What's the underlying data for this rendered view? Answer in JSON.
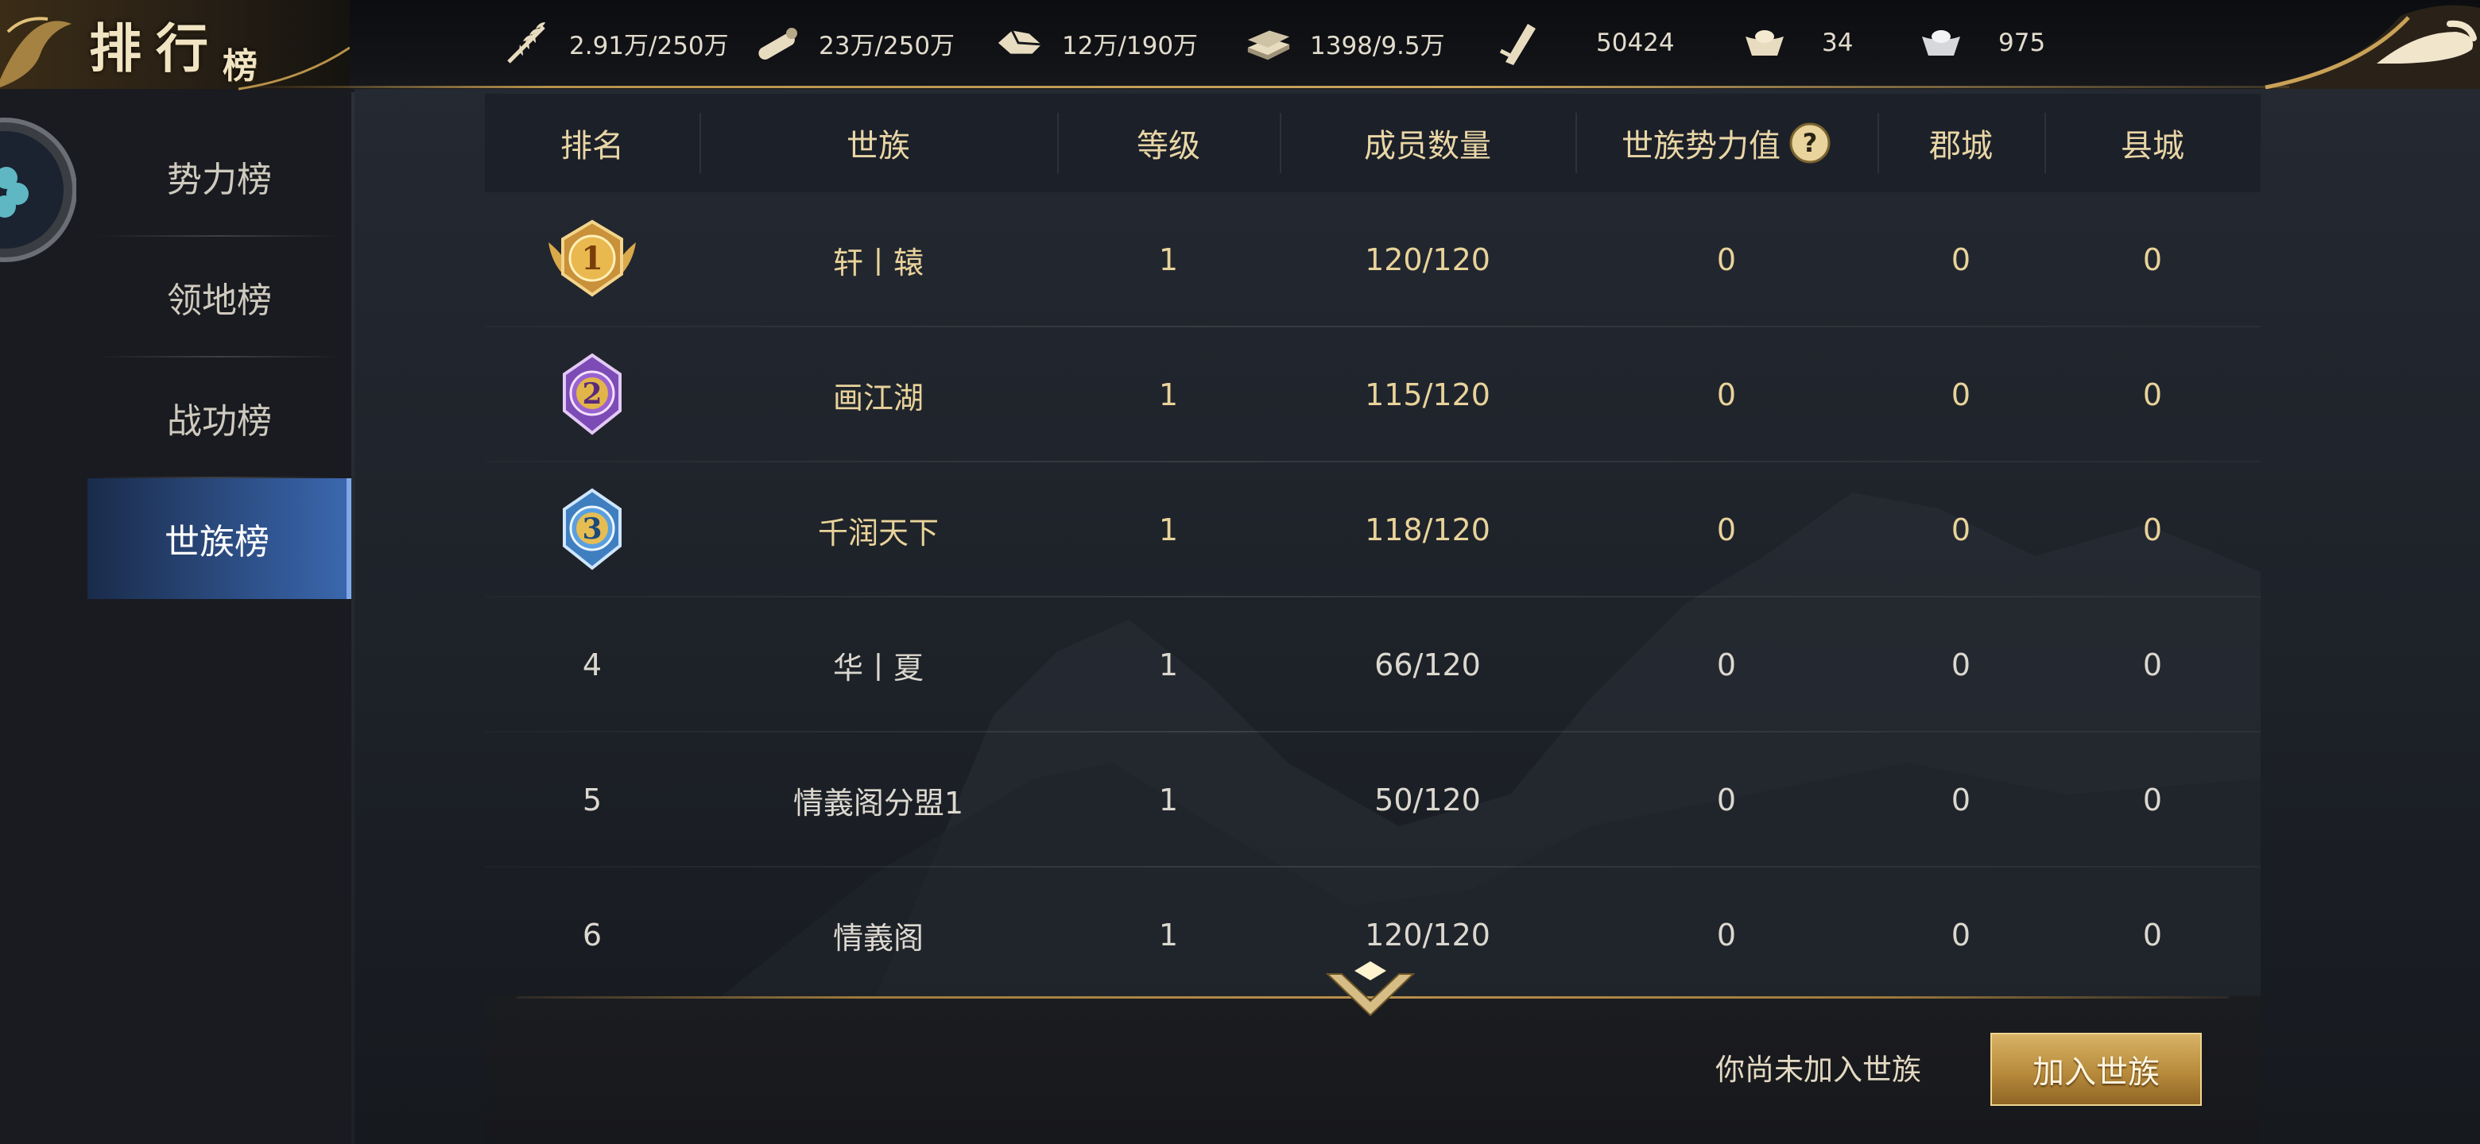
{
  "header": {
    "title_main": "排行",
    "title_small": "榜",
    "resources": [
      {
        "icon": "wheat-icon",
        "value": "2.91万/250万"
      },
      {
        "icon": "wood-icon",
        "value": "23万/250万"
      },
      {
        "icon": "stone-icon",
        "value": "12万/190万"
      },
      {
        "icon": "iron-ingot-icon",
        "value": "1398/9.5万"
      },
      {
        "icon": "military-order-icon",
        "value": "50424"
      },
      {
        "icon": "gold-ingot-icon",
        "value": "34"
      },
      {
        "icon": "silver-ingot-icon",
        "value": "975"
      }
    ]
  },
  "sidebar": {
    "items": [
      {
        "label": "势力榜",
        "active": false
      },
      {
        "label": "领地榜",
        "active": false
      },
      {
        "label": "战功榜",
        "active": false
      },
      {
        "label": "世族榜",
        "active": true
      }
    ]
  },
  "table": {
    "headers": {
      "rank": "排名",
      "clan": "世族",
      "level": "等级",
      "members": "成员数量",
      "power": "世族势力值",
      "prefecture": "郡城",
      "county": "县城"
    },
    "rows": [
      {
        "rank": "1",
        "medal": "gold-rank-1-icon",
        "clan": "轩丨辕",
        "level": "1",
        "members": "120/120",
        "power": "0",
        "prefecture": "0",
        "county": "0"
      },
      {
        "rank": "2",
        "medal": "purple-rank-2-icon",
        "clan": "画江湖",
        "level": "1",
        "members": "115/120",
        "power": "0",
        "prefecture": "0",
        "county": "0"
      },
      {
        "rank": "3",
        "medal": "blue-rank-3-icon",
        "clan": "千润天下",
        "level": "1",
        "members": "118/120",
        "power": "0",
        "prefecture": "0",
        "county": "0"
      },
      {
        "rank": "4",
        "medal": "",
        "clan": "华丨夏",
        "level": "1",
        "members": "66/120",
        "power": "0",
        "prefecture": "0",
        "county": "0"
      },
      {
        "rank": "5",
        "medal": "",
        "clan": "情義阁分盟1",
        "level": "1",
        "members": "50/120",
        "power": "0",
        "prefecture": "0",
        "county": "0"
      },
      {
        "rank": "6",
        "medal": "",
        "clan": "情義阁",
        "level": "1",
        "members": "120/120",
        "power": "0",
        "prefecture": "0",
        "county": "0"
      }
    ]
  },
  "footer": {
    "status_text": "你尚未加入世族",
    "join_label": "加入世族"
  },
  "colors": {
    "gold_text": "#e9d39a",
    "active_tab": "#2d4f86",
    "button_gold": "#c89c4e"
  }
}
